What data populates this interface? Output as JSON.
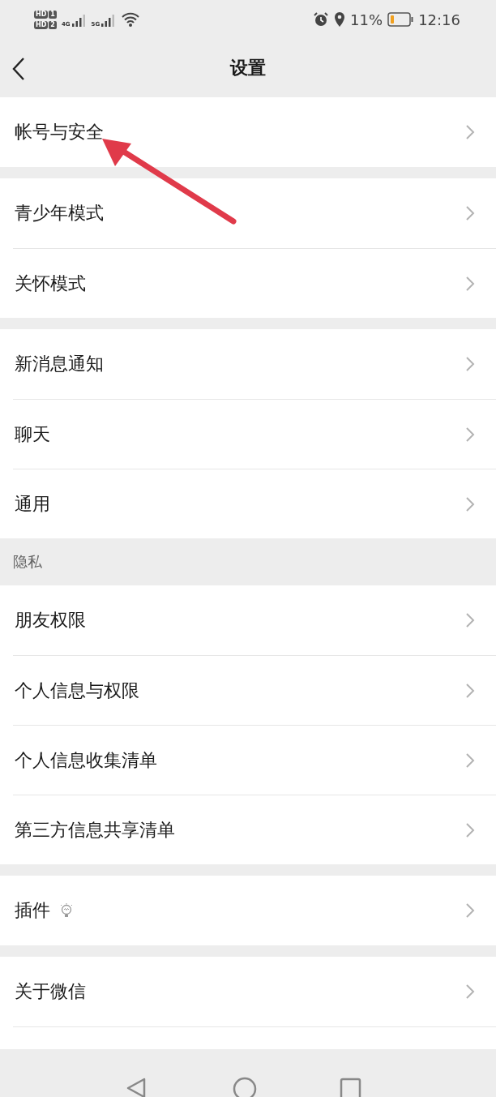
{
  "status_bar": {
    "hd_badges": [
      {
        "label": "HD",
        "sim": "1"
      },
      {
        "label": "HD",
        "sim": "2"
      }
    ],
    "networks": [
      "4G",
      "5G"
    ],
    "battery": "11%",
    "time": "12:16"
  },
  "header": {
    "title": "设置"
  },
  "groups": [
    {
      "items": [
        {
          "label": "帐号与安全"
        }
      ]
    },
    {
      "items": [
        {
          "label": "青少年模式"
        },
        {
          "label": "关怀模式"
        }
      ]
    },
    {
      "items": [
        {
          "label": "新消息通知"
        },
        {
          "label": "聊天"
        },
        {
          "label": "通用"
        }
      ]
    },
    {
      "header": "隐私",
      "items": [
        {
          "label": "朋友权限"
        },
        {
          "label": "个人信息与权限"
        },
        {
          "label": "个人信息收集清单"
        },
        {
          "label": "第三方信息共享清单"
        }
      ]
    },
    {
      "items": [
        {
          "label": "插件",
          "has_icon": true
        }
      ]
    },
    {
      "items": [
        {
          "label": "关于微信"
        }
      ],
      "more_below": true
    }
  ]
}
